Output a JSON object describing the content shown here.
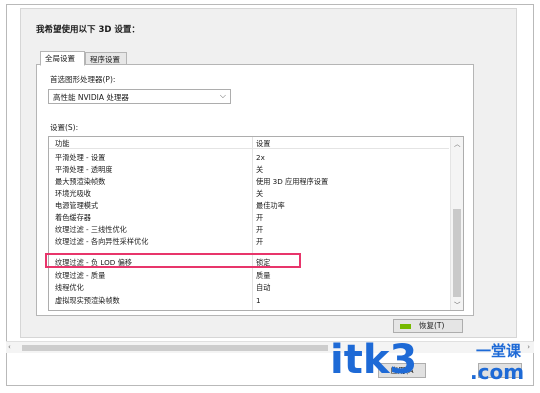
{
  "heading": "我希望使用以下 3D 设置：",
  "tabs": [
    {
      "label": "全局设置",
      "active": true
    },
    {
      "label": "程序设置",
      "active": false
    }
  ],
  "processor": {
    "label": "首选图形处理器(P):",
    "selected": "高性能 NVIDIA 处理器"
  },
  "settings": {
    "label": "设置(S):",
    "columns": [
      "功能",
      "设置"
    ],
    "rows": [
      {
        "feature": "平滑处理 - 设置",
        "value": "2x"
      },
      {
        "feature": "平滑处理 - 透明度",
        "value": "关"
      },
      {
        "feature": "最大预渲染帧数",
        "value": "使用 3D 应用程序设置"
      },
      {
        "feature": "环境光吸收",
        "value": "关"
      },
      {
        "feature": "电源管理模式",
        "value": "最佳功率"
      },
      {
        "feature": "着色缓存器",
        "value": "开"
      },
      {
        "feature": "纹理过滤 - 三线性优化",
        "value": "开"
      },
      {
        "feature": "纹理过滤 - 各向异性采样优化",
        "value": "开"
      },
      {
        "feature": "纹理过滤 - 负 LOD 偏移",
        "value": "锁定"
      },
      {
        "feature": "纹理过滤 - 质量",
        "value": "质量"
      },
      {
        "feature": "线程优化",
        "value": "自动"
      },
      {
        "feature": "虚拟现实预渲染帧数",
        "value": "1"
      }
    ],
    "highlighted_row": 8
  },
  "restore_button": "恢复(T)",
  "apply_button": "应用(A",
  "watermark": {
    "main": "itk3",
    "sub": "一堂课",
    "com": ".com"
  },
  "colors": {
    "highlight": "#e8356b",
    "nvidia": "#76b900",
    "watermark": "#1e6ad6"
  },
  "icons": [
    "nvidia-logo-icon",
    "chevron-down-icon",
    "scroll-up-icon",
    "scroll-down-icon",
    "scroll-left-icon",
    "scroll-right-icon"
  ]
}
